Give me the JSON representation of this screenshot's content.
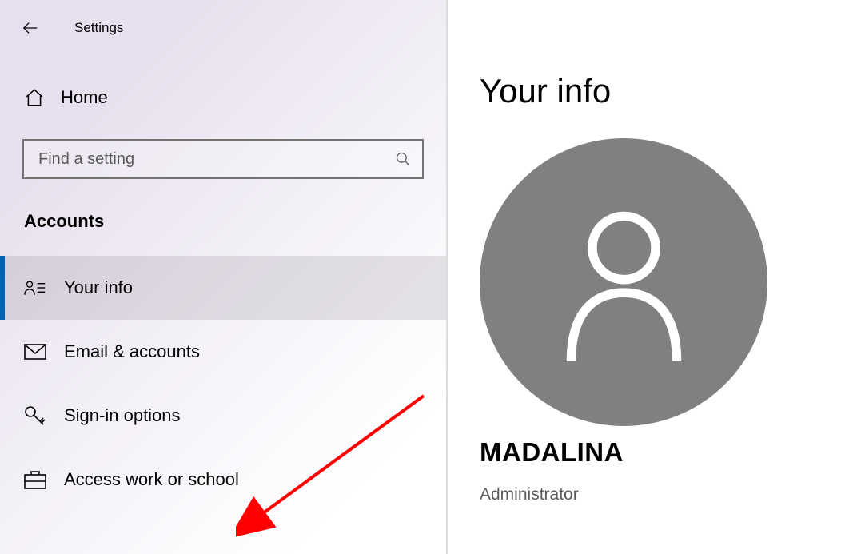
{
  "header": {
    "title": "Settings"
  },
  "home": {
    "label": "Home"
  },
  "search": {
    "placeholder": "Find a setting"
  },
  "section": {
    "title": "Accounts"
  },
  "nav": {
    "items": [
      {
        "label": "Your info",
        "selected": true,
        "icon": "person-list"
      },
      {
        "label": "Email & accounts",
        "selected": false,
        "icon": "mail"
      },
      {
        "label": "Sign-in options",
        "selected": false,
        "icon": "key"
      },
      {
        "label": "Access work or school",
        "selected": false,
        "icon": "briefcase"
      }
    ]
  },
  "page": {
    "title": "Your info",
    "user_name": "MADALINA",
    "user_role": "Administrator"
  },
  "colors": {
    "accent": "#0063b1",
    "annotation": "#ff0000"
  }
}
